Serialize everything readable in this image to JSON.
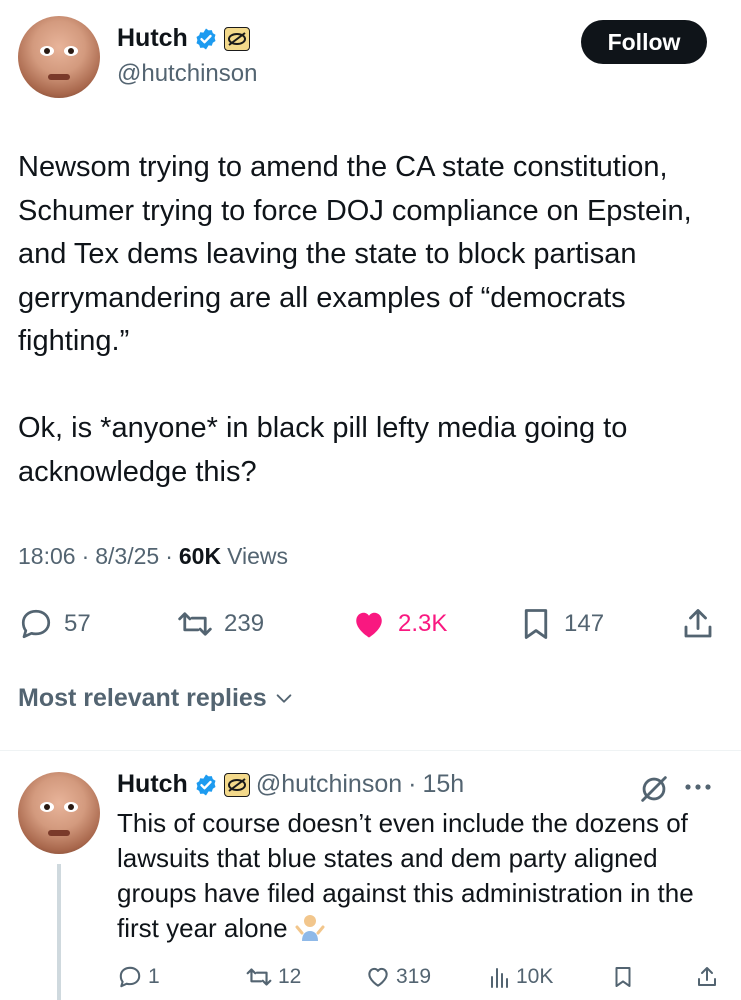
{
  "post": {
    "author": {
      "display_name": "Hutch",
      "handle": "@hutchinson",
      "verified": true
    },
    "follow_label": "Follow",
    "paragraphs": [
      "Newsom trying to amend the CA state constitution, Schumer trying to force DOJ compliance on Epstein, and Tex dems leaving the state to block partisan gerrymandering are all examples of “democrats fighting.”",
      "Ok, is *anyone* in black pill lefty media going to acknowledge this?"
    ],
    "time": "18:06",
    "date": "8/3/25",
    "views_count": "60K",
    "views_label": "Views",
    "separator": "·",
    "stats": {
      "replies": "57",
      "reposts": "239",
      "likes": "2.3K",
      "bookmarks": "147"
    }
  },
  "replies_sort": {
    "label": "Most relevant replies"
  },
  "reply": {
    "display_name": "Hutch",
    "handle": "@hutchinson",
    "separator": "·",
    "time": "15h",
    "text": "This of course doesn’t even include the dozens of lawsuits that blue states and dem party aligned groups have filed against this administration in the first year alone",
    "stats": {
      "replies": "1",
      "reposts": "12",
      "likes": "319",
      "views": "10K"
    }
  },
  "colors": {
    "text": "#0f1419",
    "secondary": "#536471",
    "like": "#f91880",
    "verified": "#1d9bf0",
    "divider": "#eff3f4"
  },
  "icons": [
    "verified-badge-icon",
    "org-badge-icon",
    "reply-icon",
    "repost-icon",
    "heart-icon",
    "bookmark-icon",
    "share-icon",
    "chevron-down-icon",
    "grok-icon",
    "more-icon",
    "views-icon",
    "shrug-emoji"
  ]
}
